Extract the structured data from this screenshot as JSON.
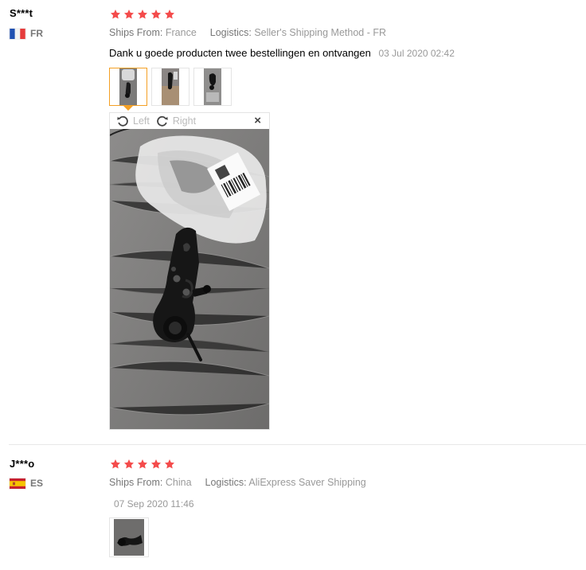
{
  "reviews": [
    {
      "user": "S***t",
      "country_code": "FR",
      "flag": "france-flag-icon",
      "rating": 5,
      "ships_from_label": "Ships From:",
      "ships_from": "France",
      "logistics_label": "Logistics:",
      "logistics": "Seller's Shipping Method - FR",
      "feedback": "Dank u goede producten twee bestellingen en ontvangen",
      "date": "03 Jul 2020 02:42",
      "photos": 3,
      "viewer": {
        "rotate_left_label": "Left",
        "rotate_right_label": "Right",
        "close_label": "×"
      }
    },
    {
      "user": "J***o",
      "country_code": "ES",
      "flag": "spain-flag-icon",
      "rating": 5,
      "ships_from_label": "Ships From:",
      "ships_from": "China",
      "logistics_label": "Logistics:",
      "logistics": "AliExpress Saver Shipping",
      "feedback": "",
      "date": "07 Sep 2020 11:46",
      "photos": 1
    }
  ],
  "colors": {
    "star": "#f44b4b",
    "active_thumb": "#f4a024",
    "label_text": "#777777",
    "muted_text": "#999999"
  }
}
